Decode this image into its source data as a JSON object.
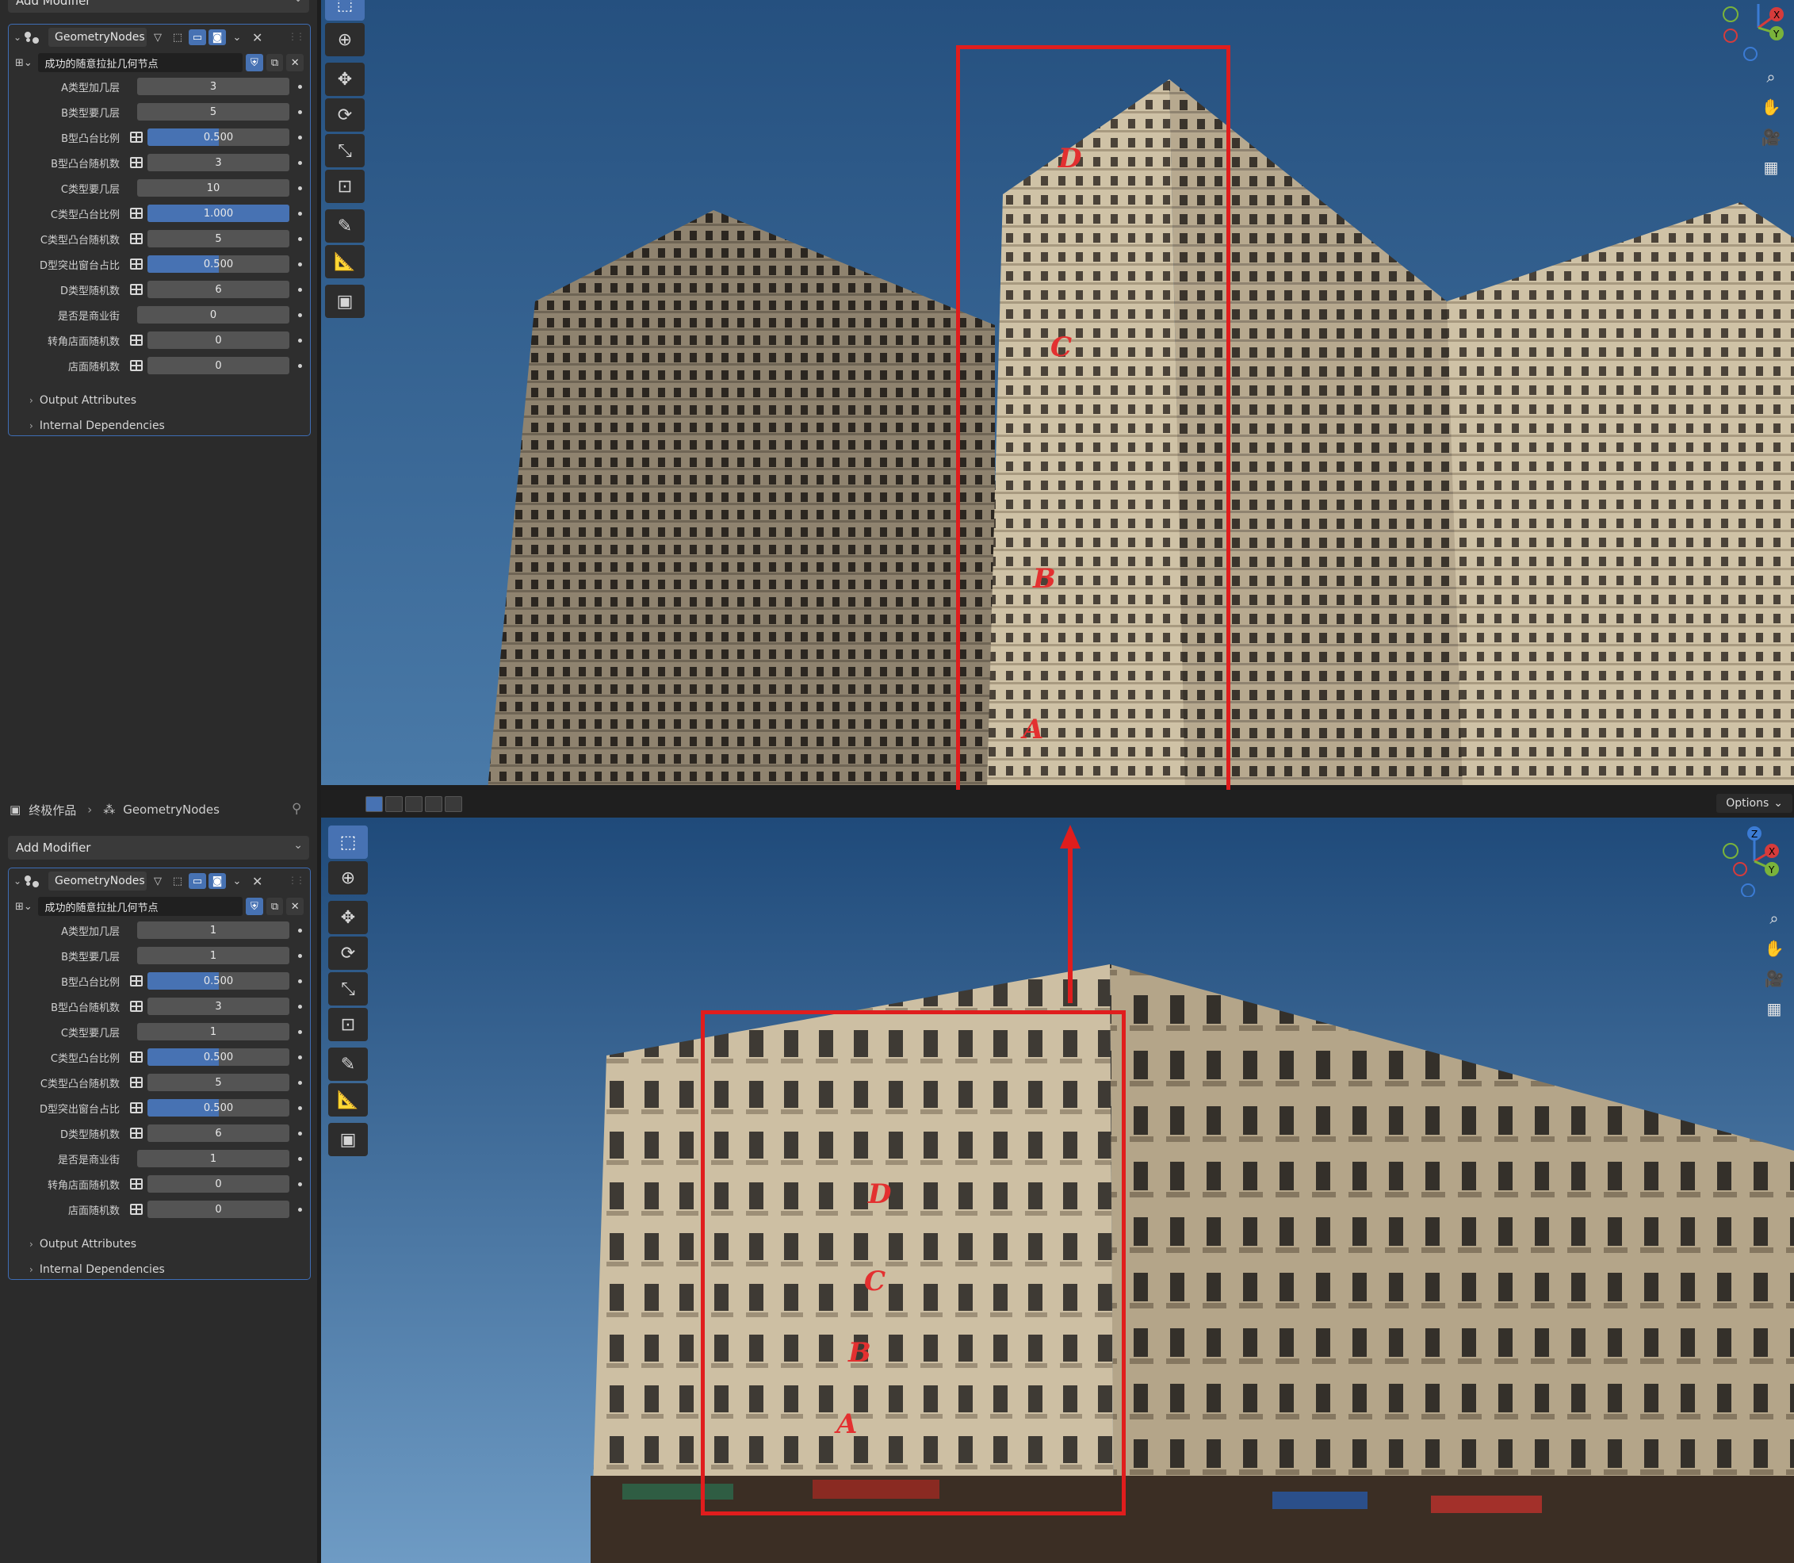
{
  "top_panel": {
    "add_modifier": "Add Modifier",
    "modifier_name": "GeometryNodes",
    "node_tree": "成功的随意拉扯几何节点",
    "params": [
      {
        "label": "A类型加几层",
        "value": "3",
        "attr": false,
        "fill": 0
      },
      {
        "label": "B类型要几层",
        "value": "5",
        "attr": false,
        "fill": 0
      },
      {
        "label": "B型凸台比例",
        "value": "0.500",
        "attr": true,
        "fill": 0.5
      },
      {
        "label": "B型凸台随机数",
        "value": "3",
        "attr": true,
        "fill": 0
      },
      {
        "label": "C类型要几层",
        "value": "10",
        "attr": false,
        "fill": 0
      },
      {
        "label": "C类型凸台比例",
        "value": "1.000",
        "attr": true,
        "fill": 1.0
      },
      {
        "label": "C类型凸台随机数",
        "value": "5",
        "attr": true,
        "fill": 0
      },
      {
        "label": "D型突出窗台占比",
        "value": "0.500",
        "attr": true,
        "fill": 0.5
      },
      {
        "label": "D类型随机数",
        "value": "6",
        "attr": true,
        "fill": 0
      },
      {
        "label": "是否是商业街",
        "value": "0",
        "attr": false,
        "fill": 0
      },
      {
        "label": "转角店面随机数",
        "value": "0",
        "attr": true,
        "fill": 0
      },
      {
        "label": "店面随机数",
        "value": "0",
        "attr": true,
        "fill": 0
      }
    ],
    "output_attributes": "Output Attributes",
    "internal_dependencies": "Internal Dependencies"
  },
  "bottom_panel": {
    "breadcrumb_object": "终极作品",
    "breadcrumb_modifier": "GeometryNodes",
    "add_modifier": "Add Modifier",
    "modifier_name": "GeometryNodes",
    "node_tree": "成功的随意拉扯几何节点",
    "params": [
      {
        "label": "A类型加几层",
        "value": "1",
        "attr": false,
        "fill": 0
      },
      {
        "label": "B类型要几层",
        "value": "1",
        "attr": false,
        "fill": 0
      },
      {
        "label": "B型凸台比例",
        "value": "0.500",
        "attr": true,
        "fill": 0.5
      },
      {
        "label": "B型凸台随机数",
        "value": "3",
        "attr": true,
        "fill": 0
      },
      {
        "label": "C类型要几层",
        "value": "1",
        "attr": false,
        "fill": 0
      },
      {
        "label": "C类型凸台比例",
        "value": "0.500",
        "attr": true,
        "fill": 0.5
      },
      {
        "label": "C类型凸台随机数",
        "value": "5",
        "attr": true,
        "fill": 0
      },
      {
        "label": "D型突出窗台占比",
        "value": "0.500",
        "attr": true,
        "fill": 0.5
      },
      {
        "label": "D类型随机数",
        "value": "6",
        "attr": true,
        "fill": 0
      },
      {
        "label": "是否是商业街",
        "value": "1",
        "attr": false,
        "fill": 0
      },
      {
        "label": "转角店面随机数",
        "value": "0",
        "attr": true,
        "fill": 0
      },
      {
        "label": "店面随机数",
        "value": "0",
        "attr": true,
        "fill": 0
      }
    ],
    "output_attributes": "Output Attributes",
    "internal_dependencies": "Internal Dependencies"
  },
  "viewport_header": {
    "options": "Options"
  },
  "annotations": {
    "top": [
      "D",
      "C",
      "B",
      "A"
    ],
    "bottom": [
      "D",
      "C",
      "B",
      "A"
    ]
  },
  "gizmo": {
    "x": "X",
    "y": "Y",
    "z": "Z"
  },
  "colors": {
    "accent": "#4772b3",
    "annotation_red": "#e01d1d",
    "panel_bg": "#2b2b2b",
    "sky": "#2e5a8a"
  }
}
